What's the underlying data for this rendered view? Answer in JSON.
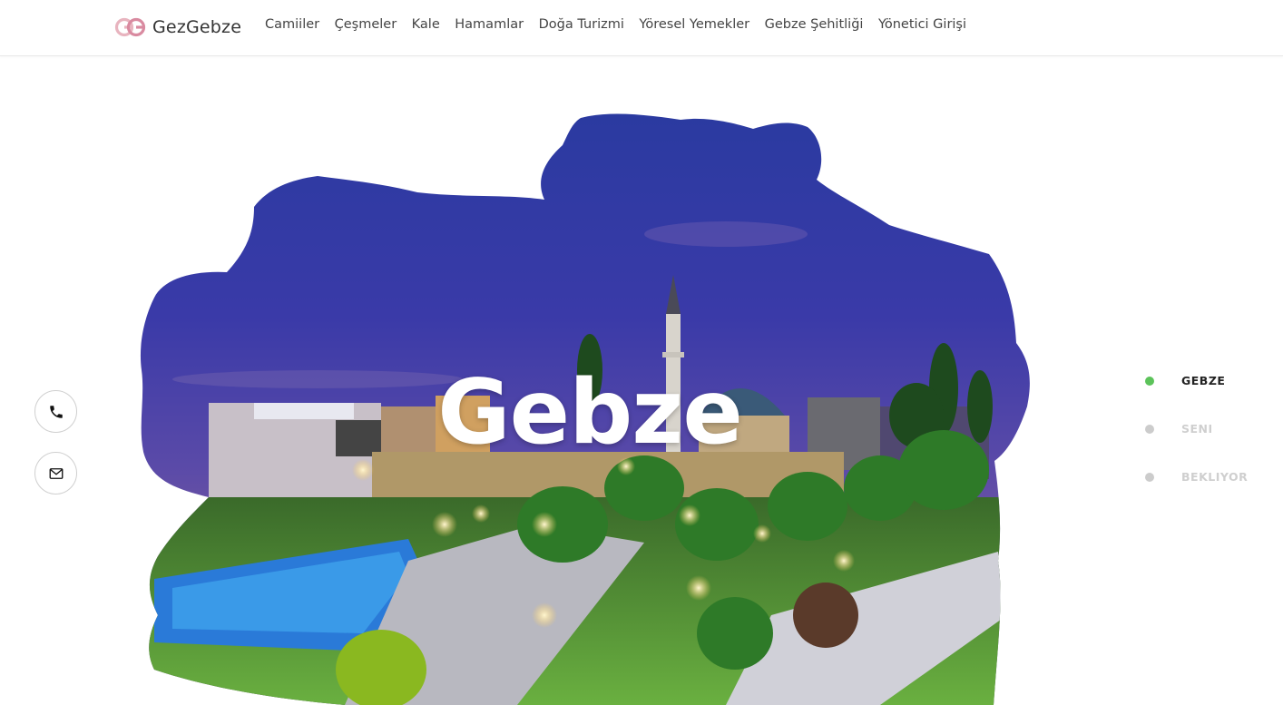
{
  "brand": {
    "name": "GezGebze",
    "logo": "GG-logo-icon",
    "logo_color": "#e8a0b0"
  },
  "nav": {
    "items": [
      {
        "label": "Camiiler"
      },
      {
        "label": "Çeşmeler"
      },
      {
        "label": "Kale"
      },
      {
        "label": "Hamamlar"
      },
      {
        "label": "Doğa Turizmi"
      },
      {
        "label": "Yöresel Yemekler"
      },
      {
        "label": "Gebze Şehitliği"
      },
      {
        "label": "Yönetici Girişi"
      }
    ]
  },
  "hero": {
    "title": "Gebze",
    "image": "gebze-night-city-photo"
  },
  "contact": {
    "phone_icon": "phone-icon",
    "mail_icon": "mail-icon"
  },
  "slides": [
    {
      "label": "GEBZE",
      "active": true
    },
    {
      "label": "SENI",
      "active": false
    },
    {
      "label": "BEKLIYOR",
      "active": false
    }
  ],
  "colors": {
    "accent": "#5cc35a",
    "inactive": "#cccccc"
  }
}
